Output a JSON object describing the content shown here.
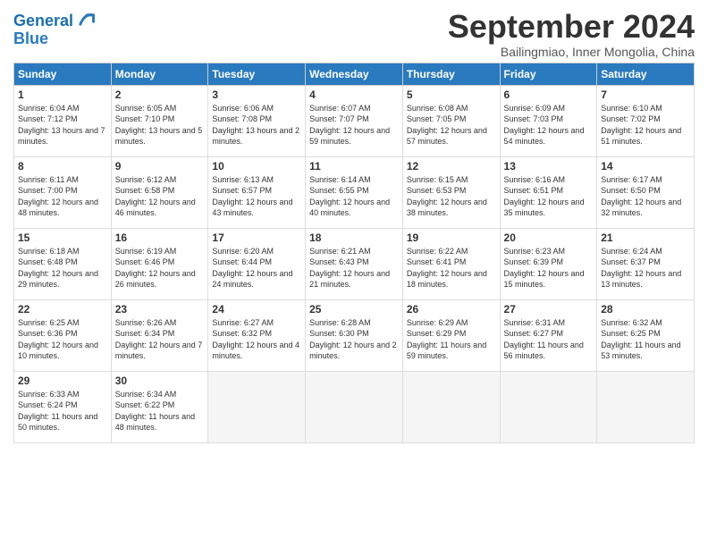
{
  "header": {
    "logo_line1": "General",
    "logo_line2": "Blue",
    "month": "September 2024",
    "location": "Bailingmiao, Inner Mongolia, China"
  },
  "days_of_week": [
    "Sunday",
    "Monday",
    "Tuesday",
    "Wednesday",
    "Thursday",
    "Friday",
    "Saturday"
  ],
  "weeks": [
    [
      {
        "num": "1",
        "sunrise": "Sunrise: 6:04 AM",
        "sunset": "Sunset: 7:12 PM",
        "daylight": "Daylight: 13 hours and 7 minutes."
      },
      {
        "num": "2",
        "sunrise": "Sunrise: 6:05 AM",
        "sunset": "Sunset: 7:10 PM",
        "daylight": "Daylight: 13 hours and 5 minutes."
      },
      {
        "num": "3",
        "sunrise": "Sunrise: 6:06 AM",
        "sunset": "Sunset: 7:08 PM",
        "daylight": "Daylight: 13 hours and 2 minutes."
      },
      {
        "num": "4",
        "sunrise": "Sunrise: 6:07 AM",
        "sunset": "Sunset: 7:07 PM",
        "daylight": "Daylight: 12 hours and 59 minutes."
      },
      {
        "num": "5",
        "sunrise": "Sunrise: 6:08 AM",
        "sunset": "Sunset: 7:05 PM",
        "daylight": "Daylight: 12 hours and 57 minutes."
      },
      {
        "num": "6",
        "sunrise": "Sunrise: 6:09 AM",
        "sunset": "Sunset: 7:03 PM",
        "daylight": "Daylight: 12 hours and 54 minutes."
      },
      {
        "num": "7",
        "sunrise": "Sunrise: 6:10 AM",
        "sunset": "Sunset: 7:02 PM",
        "daylight": "Daylight: 12 hours and 51 minutes."
      }
    ],
    [
      {
        "num": "8",
        "sunrise": "Sunrise: 6:11 AM",
        "sunset": "Sunset: 7:00 PM",
        "daylight": "Daylight: 12 hours and 48 minutes."
      },
      {
        "num": "9",
        "sunrise": "Sunrise: 6:12 AM",
        "sunset": "Sunset: 6:58 PM",
        "daylight": "Daylight: 12 hours and 46 minutes."
      },
      {
        "num": "10",
        "sunrise": "Sunrise: 6:13 AM",
        "sunset": "Sunset: 6:57 PM",
        "daylight": "Daylight: 12 hours and 43 minutes."
      },
      {
        "num": "11",
        "sunrise": "Sunrise: 6:14 AM",
        "sunset": "Sunset: 6:55 PM",
        "daylight": "Daylight: 12 hours and 40 minutes."
      },
      {
        "num": "12",
        "sunrise": "Sunrise: 6:15 AM",
        "sunset": "Sunset: 6:53 PM",
        "daylight": "Daylight: 12 hours and 38 minutes."
      },
      {
        "num": "13",
        "sunrise": "Sunrise: 6:16 AM",
        "sunset": "Sunset: 6:51 PM",
        "daylight": "Daylight: 12 hours and 35 minutes."
      },
      {
        "num": "14",
        "sunrise": "Sunrise: 6:17 AM",
        "sunset": "Sunset: 6:50 PM",
        "daylight": "Daylight: 12 hours and 32 minutes."
      }
    ],
    [
      {
        "num": "15",
        "sunrise": "Sunrise: 6:18 AM",
        "sunset": "Sunset: 6:48 PM",
        "daylight": "Daylight: 12 hours and 29 minutes."
      },
      {
        "num": "16",
        "sunrise": "Sunrise: 6:19 AM",
        "sunset": "Sunset: 6:46 PM",
        "daylight": "Daylight: 12 hours and 26 minutes."
      },
      {
        "num": "17",
        "sunrise": "Sunrise: 6:20 AM",
        "sunset": "Sunset: 6:44 PM",
        "daylight": "Daylight: 12 hours and 24 minutes."
      },
      {
        "num": "18",
        "sunrise": "Sunrise: 6:21 AM",
        "sunset": "Sunset: 6:43 PM",
        "daylight": "Daylight: 12 hours and 21 minutes."
      },
      {
        "num": "19",
        "sunrise": "Sunrise: 6:22 AM",
        "sunset": "Sunset: 6:41 PM",
        "daylight": "Daylight: 12 hours and 18 minutes."
      },
      {
        "num": "20",
        "sunrise": "Sunrise: 6:23 AM",
        "sunset": "Sunset: 6:39 PM",
        "daylight": "Daylight: 12 hours and 15 minutes."
      },
      {
        "num": "21",
        "sunrise": "Sunrise: 6:24 AM",
        "sunset": "Sunset: 6:37 PM",
        "daylight": "Daylight: 12 hours and 13 minutes."
      }
    ],
    [
      {
        "num": "22",
        "sunrise": "Sunrise: 6:25 AM",
        "sunset": "Sunset: 6:36 PM",
        "daylight": "Daylight: 12 hours and 10 minutes."
      },
      {
        "num": "23",
        "sunrise": "Sunrise: 6:26 AM",
        "sunset": "Sunset: 6:34 PM",
        "daylight": "Daylight: 12 hours and 7 minutes."
      },
      {
        "num": "24",
        "sunrise": "Sunrise: 6:27 AM",
        "sunset": "Sunset: 6:32 PM",
        "daylight": "Daylight: 12 hours and 4 minutes."
      },
      {
        "num": "25",
        "sunrise": "Sunrise: 6:28 AM",
        "sunset": "Sunset: 6:30 PM",
        "daylight": "Daylight: 12 hours and 2 minutes."
      },
      {
        "num": "26",
        "sunrise": "Sunrise: 6:29 AM",
        "sunset": "Sunset: 6:29 PM",
        "daylight": "Daylight: 11 hours and 59 minutes."
      },
      {
        "num": "27",
        "sunrise": "Sunrise: 6:31 AM",
        "sunset": "Sunset: 6:27 PM",
        "daylight": "Daylight: 11 hours and 56 minutes."
      },
      {
        "num": "28",
        "sunrise": "Sunrise: 6:32 AM",
        "sunset": "Sunset: 6:25 PM",
        "daylight": "Daylight: 11 hours and 53 minutes."
      }
    ],
    [
      {
        "num": "29",
        "sunrise": "Sunrise: 6:33 AM",
        "sunset": "Sunset: 6:24 PM",
        "daylight": "Daylight: 11 hours and 50 minutes."
      },
      {
        "num": "30",
        "sunrise": "Sunrise: 6:34 AM",
        "sunset": "Sunset: 6:22 PM",
        "daylight": "Daylight: 11 hours and 48 minutes."
      },
      null,
      null,
      null,
      null,
      null
    ]
  ]
}
